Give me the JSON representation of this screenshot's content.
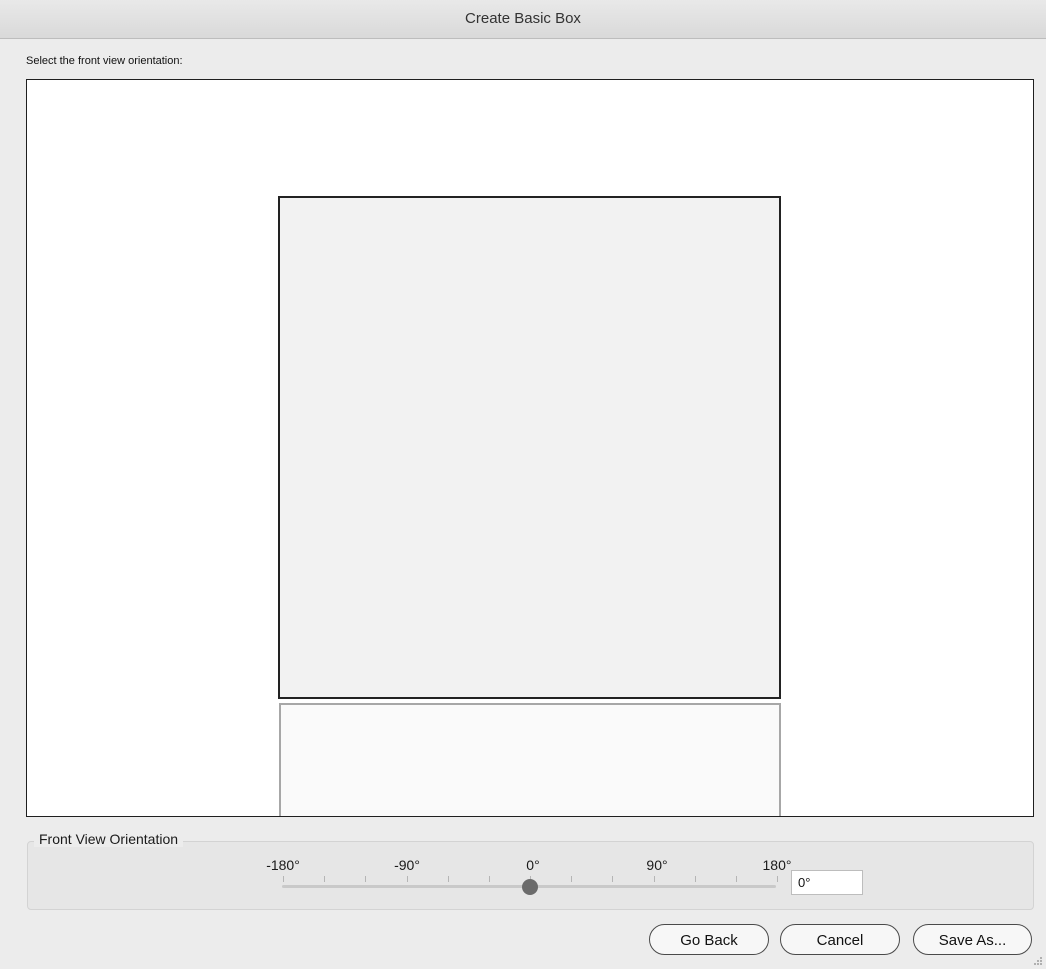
{
  "window": {
    "title": "Create Basic Box"
  },
  "instruction": "Select the front view orientation:",
  "orientation": {
    "group_title": "Front View Orientation",
    "ticks": [
      "-180°",
      "-90°",
      "0°",
      "90°",
      "180°"
    ],
    "slider_value_degrees": 0,
    "slider_range_degrees": [
      -180,
      180
    ],
    "field_value": "0°"
  },
  "buttons": {
    "go_back": "Go Back",
    "cancel": "Cancel",
    "save_as": "Save As..."
  },
  "colors": {
    "window_bg": "#ececec",
    "canvas_bg": "#ffffff",
    "box_face": "#f2f2f2",
    "slider_thumb": "#6b6b6b"
  }
}
